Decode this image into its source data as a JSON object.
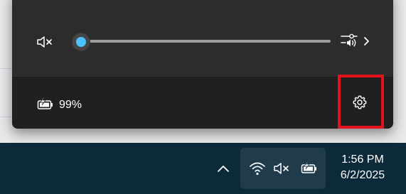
{
  "quick_settings": {
    "volume": {
      "muted": true,
      "level_fraction": 0.0,
      "mute_icon": "speaker-muted-icon",
      "output_icon": "audio-output-select-icon",
      "chevron_icon": "chevron-right-icon"
    },
    "footer": {
      "battery_percent": "99%",
      "battery_icon": "battery-charging-icon",
      "settings_icon": "gear-icon"
    }
  },
  "taskbar": {
    "tray_overflow_icon": "chevron-up-icon",
    "tray_icons": [
      "wifi-icon",
      "speaker-muted-icon",
      "battery-charging-icon"
    ],
    "clock": {
      "time": "1:56 PM",
      "date": "6/2/2025"
    }
  },
  "colors": {
    "accent": "#4cc2ff",
    "highlight_box": "#e3121b",
    "flyout_bg": "#2c2c2c",
    "taskbar_bg": "#0d2a3a"
  }
}
